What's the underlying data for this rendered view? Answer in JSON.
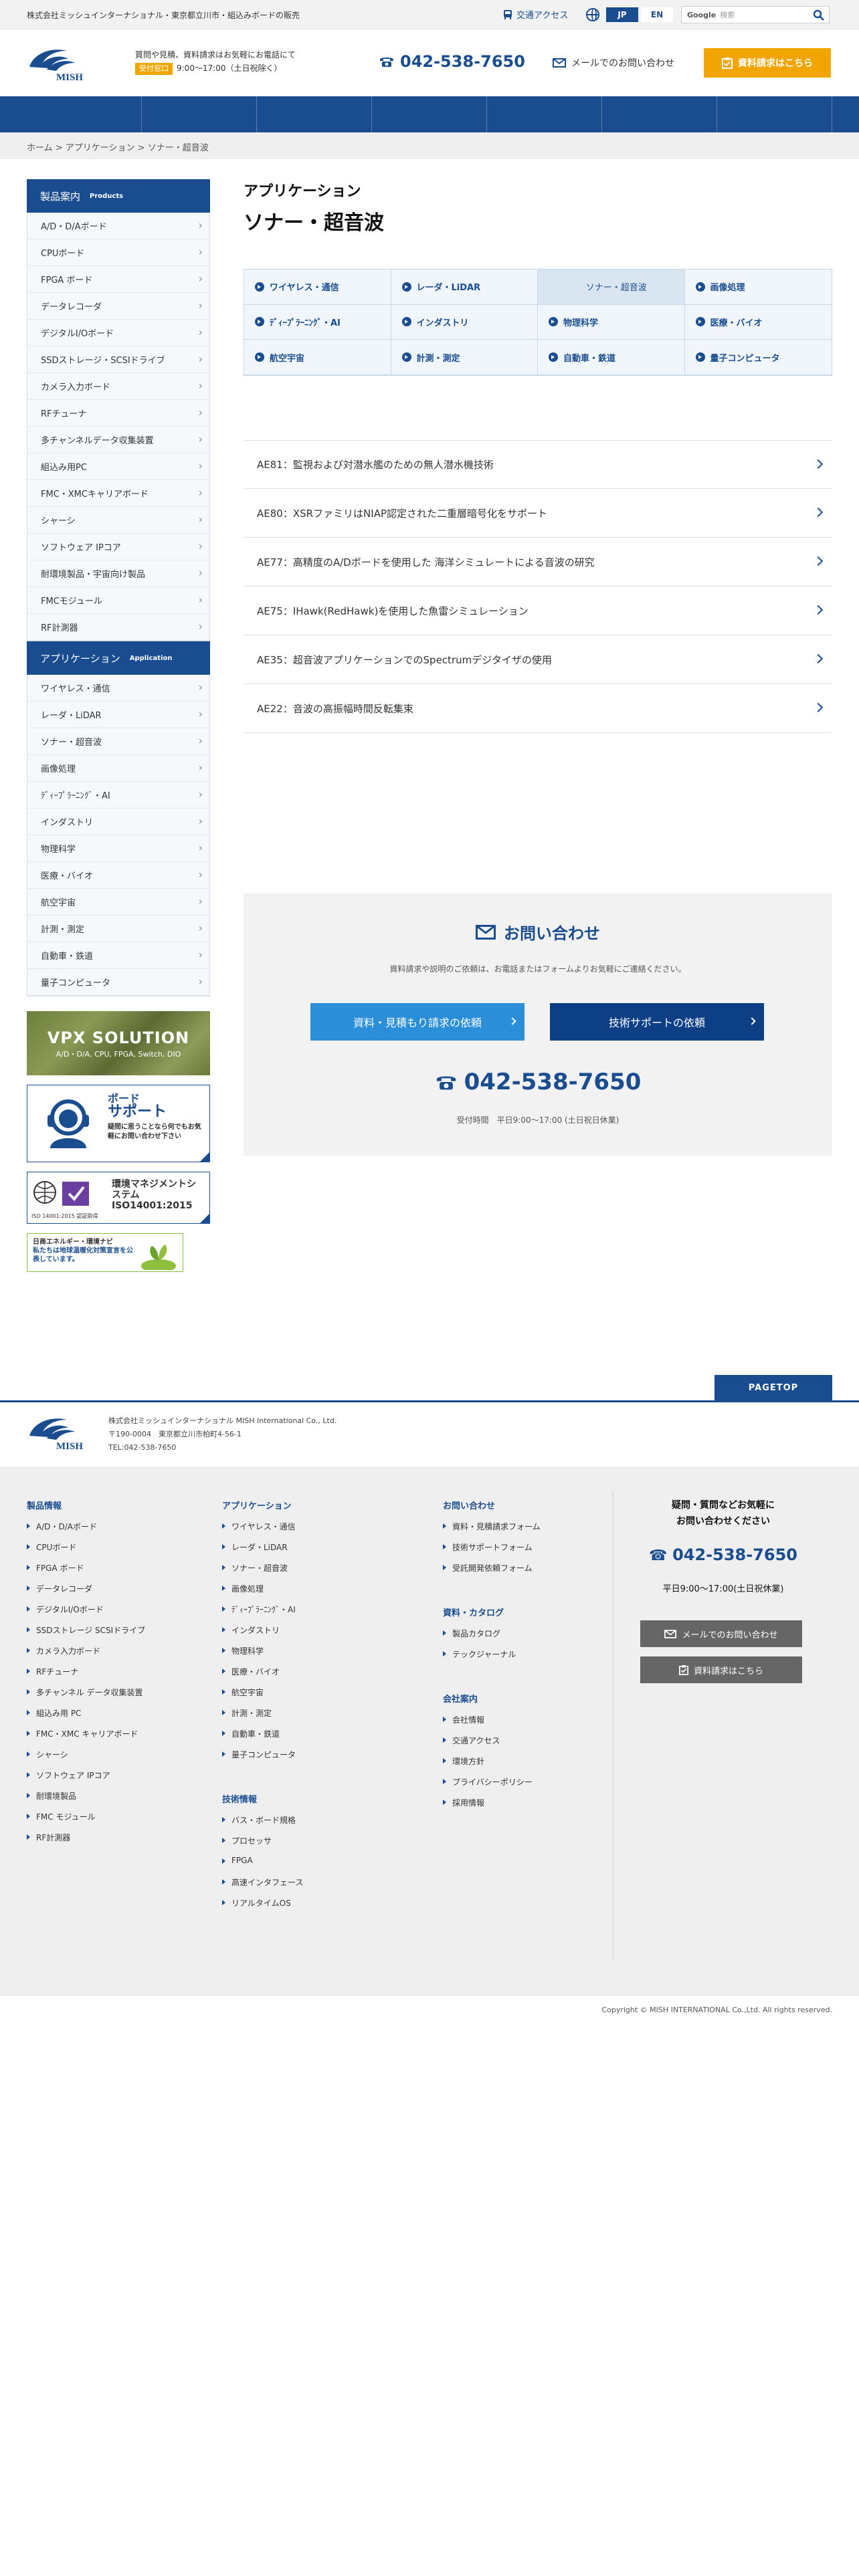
{
  "topbar": {
    "tagline": "株式会社ミッシュインターナショナル・東京都立川市・組込みボードの販売",
    "access": "交通アクセス",
    "lang_jp": "JP",
    "lang_en": "EN",
    "search_brand": "Google",
    "search_placeholder": "検索"
  },
  "header": {
    "logo_text": "MISH",
    "info_line1": "質問や見積、資料請求はお気軽にお電話にて",
    "badge": "受付窓口",
    "hours": "9:00〜17:00（土日祝除く）",
    "phone": "042-538-7650",
    "mail": "メールでのお問い合わせ",
    "doc_request": "資料請求はこちら"
  },
  "breadcrumb": {
    "home": "ホーム",
    "sep1": " > ",
    "app": "アプリケーション",
    "sep2": " > ",
    "current": "ソナー・超音波"
  },
  "sidebar": {
    "products_title": "製品案内",
    "products_sub": "Products",
    "products": [
      "A/D・D/Aボード",
      "CPUボード",
      "FPGA ボード",
      "データレコーダ",
      "デジタルI/Oボード",
      "SSDストレージ・SCSIドライブ",
      "カメラ入力ボード",
      "RFチューナ",
      "多チャンネルデータ収集装置",
      "組込み用PC",
      "FMC・XMCキャリアボード",
      "シャーシ",
      "ソフトウェア IPコア",
      "耐環境製品・宇宙向け製品",
      "FMCモジュール",
      "RF計測器"
    ],
    "apps_title": "アプリケーション",
    "apps_sub": "Application",
    "apps": [
      "ワイヤレス・通信",
      "レーダ・LiDAR",
      "ソナー・超音波",
      "画像処理",
      "ﾃﾞｨｰﾌﾟﾗｰﾆﾝｸﾞ・AI",
      "インダストリ",
      "物理科学",
      "医療・バイオ",
      "航空宇宙",
      "計測・測定",
      "自動車・鉄道",
      "量子コンピュータ"
    ],
    "banner_vpx_title": "VPX SOLUTION",
    "banner_vpx_sub": "A/D・D/A, CPU, FPGA, Switch, DIO",
    "banner_support_title1": "ボード",
    "banner_support_title2": "サポート",
    "banner_support_sub": "疑問に思うことなら何でもお気軽にお問い合わせ下さい",
    "banner_iso_title": "環境マネジメントシステム ISO14001:2015",
    "banner_iso_caption": "ISO 14001:2015 認証取得",
    "banner_eco_line1": "日商エネルギー・環境ナビ",
    "banner_eco_line2": "私たちは地球温暖化対策宣言を公表しています。"
  },
  "main": {
    "category": "アプリケーション",
    "title": "ソナー・超音波",
    "grid": [
      {
        "label": "ワイヤレス・通信",
        "active": false
      },
      {
        "label": "レーダ・LiDAR",
        "active": false
      },
      {
        "label": "ソナー・超音波",
        "active": true
      },
      {
        "label": "画像処理",
        "active": false
      },
      {
        "label": "ﾃﾞｨｰﾌﾟﾗｰﾆﾝｸﾞ・AI",
        "active": false
      },
      {
        "label": "インダストリ",
        "active": false
      },
      {
        "label": "物理科学",
        "active": false
      },
      {
        "label": "医療・バイオ",
        "active": false
      },
      {
        "label": "航空宇宙",
        "active": false
      },
      {
        "label": "計測・測定",
        "active": false
      },
      {
        "label": "自動車・鉄道",
        "active": false
      },
      {
        "label": "量子コンピュータ",
        "active": false
      }
    ],
    "articles": [
      "AE81：監視および対潜水艦のための無人潜水機技術",
      "AE80：XSRファミリはNIAP認定された二重層暗号化をサポート",
      "AE77：高精度のA/Dボードを使用した 海洋シミュレートによる音波の研究",
      "AE75：IHawk(RedHawk)を使用した魚雷シミュレーション",
      "AE35：超音波アプリケーションでのSpectrumデジタイザの使用",
      "AE22：音波の高振幅時間反転集束"
    ]
  },
  "contact": {
    "title": "お問い合わせ",
    "desc": "資料請求や説明のご依頼は、お電話またはフォームよりお気軽にご連絡ください。",
    "btn_quote": "資料・見積もり請求の依頼",
    "btn_support": "技術サポートの依頼",
    "phone": "042-538-7650",
    "hours": "受付時間　平日9:00〜17:00 (土日祝日休業)"
  },
  "pagetop": "PAGETOP",
  "footer": {
    "company_line1": "株式会社ミッシュインターナショナル MISH International Co., Ltd.",
    "company_line2": "〒190-0004　東京都立川市柏町4-56-1",
    "company_line3": "TEL:042-538-7650",
    "products_h": "製品情報",
    "products": [
      "A/D・D/Aボード",
      "CPUボード",
      "FPGA ボード",
      "データレコーダ",
      "デジタルI/Oボード",
      "SSDストレージ SCSIドライブ",
      "カメラ入力ボード",
      "RFチューナ",
      "多チャンネル データ収集装置",
      "組込み用 PC",
      "FMC・XMC キャリアボード",
      "シャーシ",
      "ソフトウェア IPコア",
      "耐環境製品",
      "FMC モジュール",
      "RF計測器"
    ],
    "apps_h": "アプリケーション",
    "apps": [
      "ワイヤレス・通信",
      "レーダ・LiDAR",
      "ソナー・超音波",
      "画像処理",
      "ﾃﾞｨｰﾌﾟﾗｰﾆﾝｸﾞ・AI",
      "インダストリ",
      "物理科学",
      "医療・バイオ",
      "航空宇宙",
      "計測・測定",
      "自動車・鉄道",
      "量子コンピュータ"
    ],
    "tech_h": "技術情報",
    "tech": [
      "バス・ボード規格",
      "プロセッサ",
      "FPGA",
      "高速インタフェース",
      "リアルタイムOS"
    ],
    "contact_h": "お問い合わせ",
    "contact": [
      "資料・見積請求フォーム",
      "技術サポートフォーム",
      "受託開発依頼フォーム"
    ],
    "catalog_h": "資料・カタログ",
    "catalog": [
      "製品カタログ",
      "テックジャーナル"
    ],
    "company_h": "会社案内",
    "company": [
      "会社情報",
      "交通アクセス",
      "環境方針",
      "プライバシーポリシー",
      "採用情報"
    ],
    "right_q1": "疑問・質問などお気軽に",
    "right_q2": "お問い合わせください",
    "right_phone": "042-538-7650",
    "right_hours": "平日9:00〜17:00(土日祝休業)",
    "right_mail": "メールでのお問い合わせ",
    "right_doc": "資料請求はこちら"
  },
  "copyright": "Copyright © MISH INTERNATIONAL Co.,Ltd. All rights reserved.",
  "colors": {
    "brand": "#1a4d8f",
    "accent": "#f0a500",
    "light": "#f0f6fb"
  }
}
